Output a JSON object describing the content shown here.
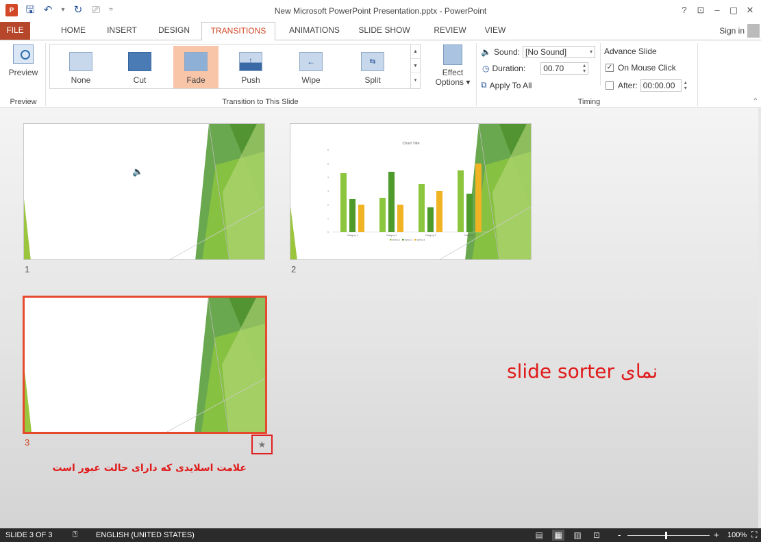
{
  "window": {
    "title": "New Microsoft PowerPoint Presentation.pptx - PowerPoint",
    "app_badge": "P",
    "controls": [
      "?",
      "⊡",
      "–",
      "▢",
      "✕"
    ]
  },
  "quick_access": {
    "icons": [
      "save-icon",
      "undo-icon",
      "redo-icon",
      "start-from-beginning-icon",
      "customize-icon"
    ],
    "undo_dropdown": "▾",
    "customize": "="
  },
  "tabs": [
    {
      "label": "FILE"
    },
    {
      "label": "HOME"
    },
    {
      "label": "INSERT"
    },
    {
      "label": "DESIGN"
    },
    {
      "label": "TRANSITIONS"
    },
    {
      "label": "ANIMATIONS"
    },
    {
      "label": "SLIDE SHOW"
    },
    {
      "label": "REVIEW"
    },
    {
      "label": "VIEW"
    }
  ],
  "active_tab": "TRANSITIONS",
  "account": {
    "sign_in": "Sign in"
  },
  "ribbon": {
    "preview_group": {
      "button": "Preview",
      "label": "Preview"
    },
    "transition_group": {
      "label": "Transition to This Slide",
      "items": [
        {
          "label": "None"
        },
        {
          "label": "Cut"
        },
        {
          "label": "Fade"
        },
        {
          "label": "Push"
        },
        {
          "label": "Wipe"
        },
        {
          "label": "Split"
        }
      ],
      "selected": "Fade",
      "effect_options_line1": "Effect",
      "effect_options_line2": "Options"
    },
    "timing_group": {
      "label": "Timing",
      "sound_label": "Sound:",
      "sound_value": "[No Sound]",
      "duration_label": "Duration:",
      "duration_value": "00.70",
      "apply_all": "Apply To All",
      "advance_title": "Advance Slide",
      "on_mouse_click": "On Mouse Click",
      "on_mouse_click_checked": true,
      "after_label": "After:",
      "after_value": "00:00.00",
      "after_checked": false
    }
  },
  "slides": [
    {
      "number": "1",
      "selected": false,
      "has_sound_icon": true
    },
    {
      "number": "2",
      "selected": false,
      "has_chart": true
    },
    {
      "number": "3",
      "selected": true,
      "transition_mark": "★"
    }
  ],
  "chart_data": {
    "type": "bar",
    "title": "Chart Title",
    "categories": [
      "Category 1",
      "Category 2",
      "Category 3",
      "Category 4"
    ],
    "series": [
      {
        "name": "Series 1",
        "values": [
          4.3,
          2.5,
          3.5,
          4.5
        ],
        "color": "#8cc63f"
      },
      {
        "name": "Series 2",
        "values": [
          2.4,
          4.4,
          1.8,
          2.8
        ],
        "color": "#4e9a2a"
      },
      {
        "name": "Series 3",
        "values": [
          2.0,
          2.0,
          3.0,
          5.0
        ],
        "color": "#f0b323"
      }
    ],
    "ylim": [
      0,
      6
    ],
    "yticks": [
      "0",
      "1",
      "2",
      "3",
      "4",
      "5",
      "6"
    ],
    "legend": "bottom",
    "grid": false
  },
  "annotations": {
    "view_caption": "نمای slide sorter",
    "mark_caption": "علامت اسلایدی که دارای حالت عبور است",
    "color": "#e01b1b"
  },
  "status": {
    "slide_info": "SLIDE 3 OF 3",
    "language": "ENGLISH (UNITED STATES)",
    "zoom": "100%",
    "zoom_minus": "-",
    "zoom_plus": "+"
  }
}
